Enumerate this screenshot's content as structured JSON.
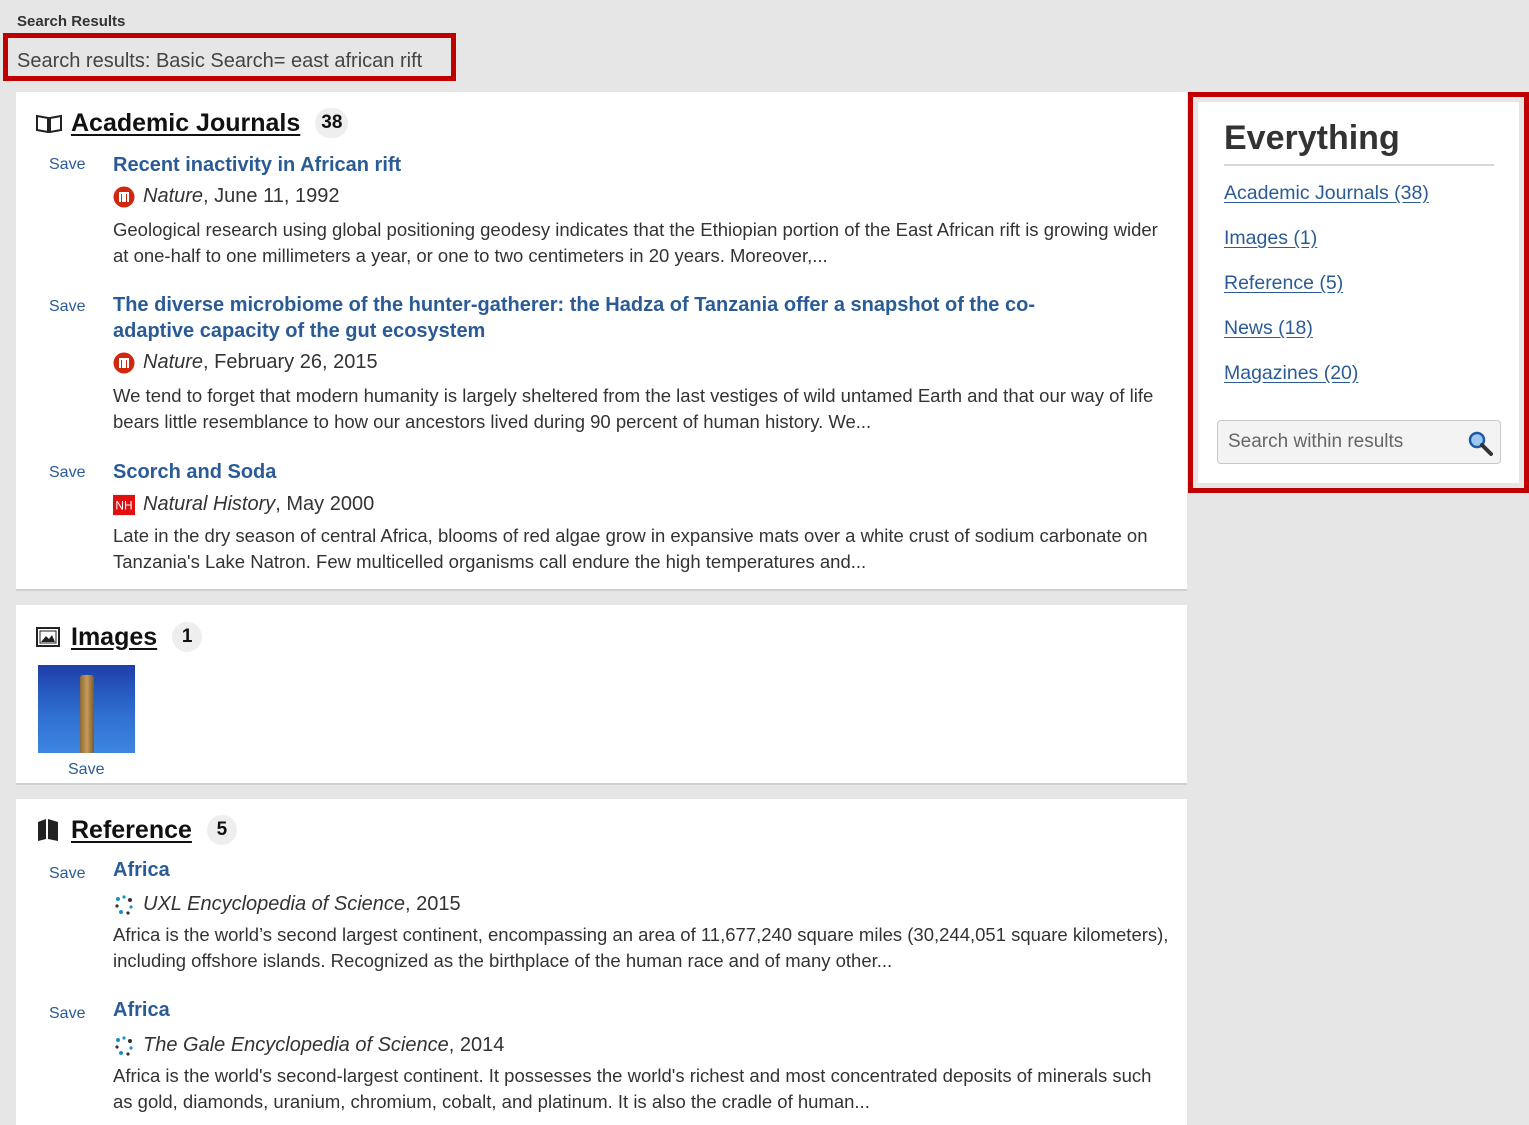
{
  "page": {
    "header_label": "Search Results",
    "query_text": "Search results: Basic Search= east african rift"
  },
  "accent_color": "#c00000",
  "link_color": "#2a5b96",
  "sections": {
    "journals": {
      "title": "Academic Journals",
      "count": "38",
      "icon": "open-book-icon",
      "results": [
        {
          "save": "Save",
          "title": "Recent inactivity in African rift",
          "source_icon": "nature-logo-icon",
          "publication": "Nature",
          "date": ", June 11, 1992",
          "snippet": "Geological research using global positioning geodesy indicates that the Ethiopian portion of the East African rift is growing wider at one-half to one millimeters a year, or one to two centimeters in 20 years. Moreover,..."
        },
        {
          "save": "Save",
          "title": "The diverse microbiome of the hunter-gatherer: the Hadza of Tanzania offer a snapshot of the co-adaptive capacity of the gut ecosystem",
          "source_icon": "nature-logo-icon",
          "publication": "Nature",
          "date": ", February 26, 2015",
          "snippet": "We tend to forget that modern humanity is largely sheltered from the last vestiges of wild untamed Earth and that our way of life bears little resemblance to how our ancestors lived during 90 percent of human history. We..."
        },
        {
          "save": "Save",
          "title": "Scorch and Soda",
          "source_icon": "natural-history-logo-icon",
          "source_icon_text": "NH",
          "publication": "Natural History",
          "date": ", May 2000",
          "snippet": "Late in the dry season of central Africa, blooms of red algae grow in expansive mats over a white crust of sodium carbonate on Tanzania's Lake Natron. Few multicelled organisms call endure the high temperatures and..."
        }
      ]
    },
    "images": {
      "title": "Images",
      "count": "1",
      "icon": "picture-icon",
      "items": [
        {
          "save": "Save",
          "thumbnail": "stone-pillar-blue-sky-thumbnail"
        }
      ]
    },
    "reference": {
      "title": "Reference",
      "count": "5",
      "icon": "closed-book-icon",
      "results": [
        {
          "save": "Save",
          "title": "Africa",
          "source_icon": "gale-reference-icon",
          "publication": "UXL Encyclopedia of Science",
          "date": ", 2015",
          "snippet": "Africa is the world’s second largest continent, encompassing an area of 11,677,240 square miles (30,244,051 square kilometers), including offshore islands. Recognized as the birthplace of the human race and of many other..."
        },
        {
          "save": "Save",
          "title": "Africa",
          "source_icon": "gale-reference-icon",
          "publication": "The Gale Encyclopedia of Science",
          "date": ", 2014",
          "snippet": "Africa is the world's second-largest continent. It possesses the world's richest and most concentrated deposits of minerals such as gold, diamonds, uranium, chromium, cobalt, and platinum. It is also the cradle of human..."
        }
      ]
    }
  },
  "sidebar": {
    "title": "Everything",
    "links": [
      "Academic Journals (38)",
      "Images (1)",
      "Reference (5)",
      "News (18)",
      "Magazines (20)"
    ],
    "search_placeholder": "Search within results",
    "search_icon": "magnifier-icon"
  }
}
